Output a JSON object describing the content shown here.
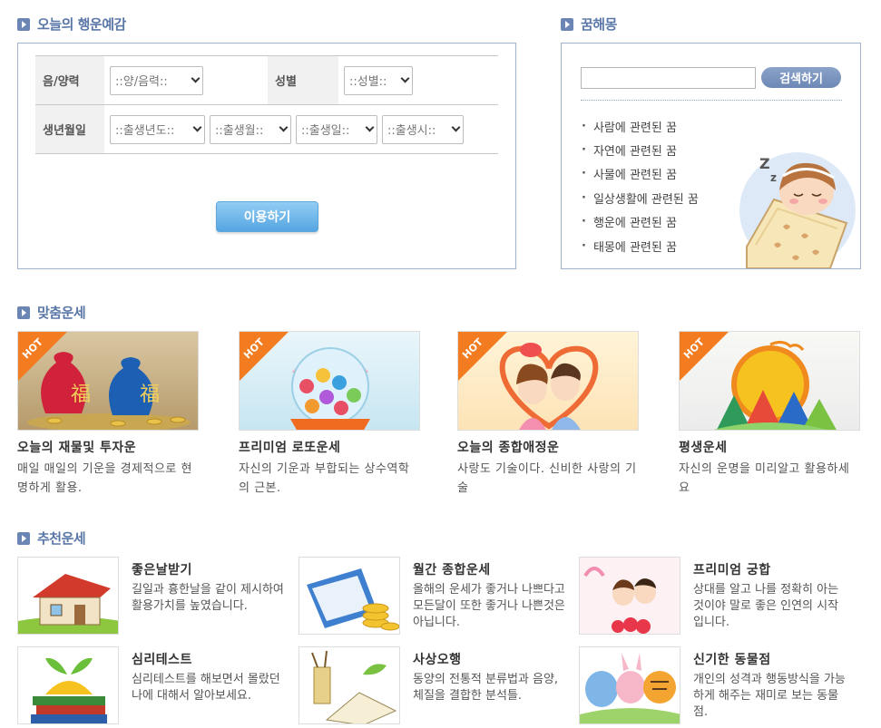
{
  "today": {
    "title": "오늘의 행운예감",
    "label_calendar": "음/양력",
    "calendar_select": "::양/음력::",
    "label_gender": "성별",
    "gender_select": "::성별::",
    "label_birth": "생년월일",
    "year_select": "::출생년도::",
    "month_select": "::출생월::",
    "day_select": "::출생일::",
    "hour_select": "::출생시::",
    "submit_label": "이용하기"
  },
  "dream": {
    "title": "꿈해몽",
    "search_value": "",
    "search_button": "검색하기",
    "items": [
      "사람에 관련된 꿈",
      "자연에 관련된 꿈",
      "사물에 관련된 꿈",
      "일상생활에 관련된 꿈",
      "행운에 관련된 꿈",
      "태몽에 관련된 꿈"
    ]
  },
  "custom": {
    "title": "맞춤운세",
    "badge": "HOT",
    "cards": [
      {
        "title": "오늘의 재물및 투자운",
        "desc": "매일 매일의 기운을 경제적으로 현명하게 활용."
      },
      {
        "title": "프리미엄 로또운세",
        "desc": "자신의 기운과 부합되는 상수역학의 근본."
      },
      {
        "title": "오늘의 종합애정운",
        "desc": "사랑도 기술이다. 신비한 사랑의 기술"
      },
      {
        "title": "평생운세",
        "desc": "자신의 운명을 미리알고 활용하세요"
      }
    ]
  },
  "recommended": {
    "title": "추천운세",
    "items": [
      {
        "title": "좋은날받기",
        "desc": "길일과 흉한날을 같이 제시하여 활용가치를 높였습니다."
      },
      {
        "title": "월간 종합운세",
        "desc": "올해의 운세가 좋거나 나쁘다고 모든달이 또한 좋거나 나쁜것은 아닙니다."
      },
      {
        "title": "프리미엄 궁합",
        "desc": "상대를 알고 나를 정확히 아는 것이야 말로 좋은 인연의 시작입니다."
      },
      {
        "title": "심리테스트",
        "desc": "심리테스트를 해보면서 몰랐던 나에 대해서 알아보세요."
      },
      {
        "title": "사상오행",
        "desc": "동양의 전통적 분류법과 음양, 체질을 결합한 분석틀."
      },
      {
        "title": "신기한 동물점",
        "desc": "개인의 성격과 행동방식을 가능하게 해주는 재미로 보는 동물점."
      }
    ]
  }
}
